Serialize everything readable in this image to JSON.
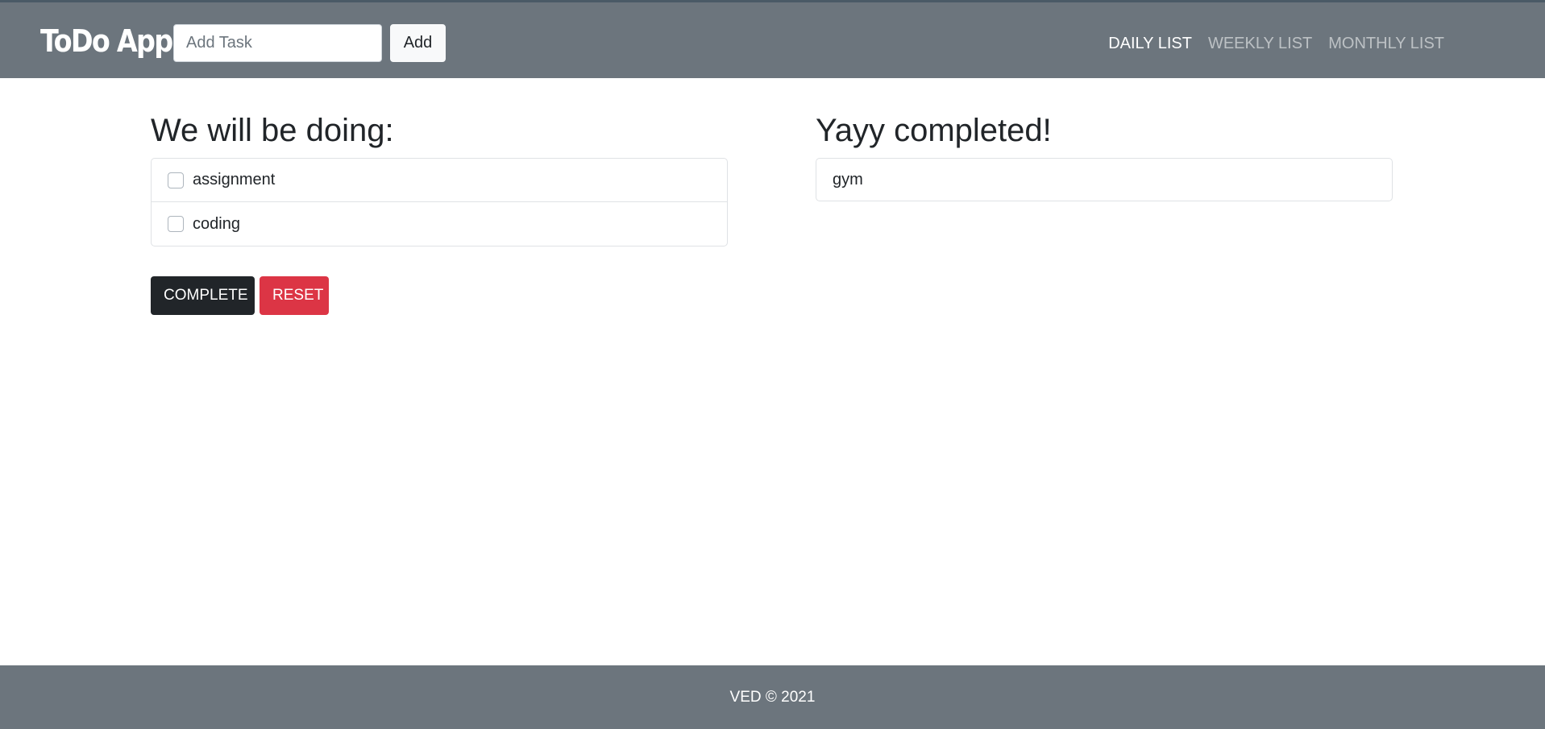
{
  "navbar": {
    "brand": "ToDo App",
    "task_input": {
      "placeholder": "Add Task",
      "value": ""
    },
    "add_label": "Add",
    "links": [
      {
        "label": "DAILY LIST",
        "active": true
      },
      {
        "label": "WEEKLY LIST",
        "active": false
      },
      {
        "label": "MONTHLY LIST",
        "active": false
      }
    ]
  },
  "todo": {
    "title": "We will be doing:",
    "items": [
      {
        "label": "assignment",
        "checked": false
      },
      {
        "label": "coding",
        "checked": false
      }
    ],
    "complete_label": "COMPLETE",
    "reset_label": "RESET"
  },
  "completed": {
    "title": "Yayy completed!",
    "items": [
      {
        "label": "gym"
      }
    ]
  },
  "footer": {
    "text": "VED © 2021"
  },
  "colors": {
    "navbar_bg": "#6c757d",
    "dark_button": "#212529",
    "danger_button": "#dc3545"
  }
}
